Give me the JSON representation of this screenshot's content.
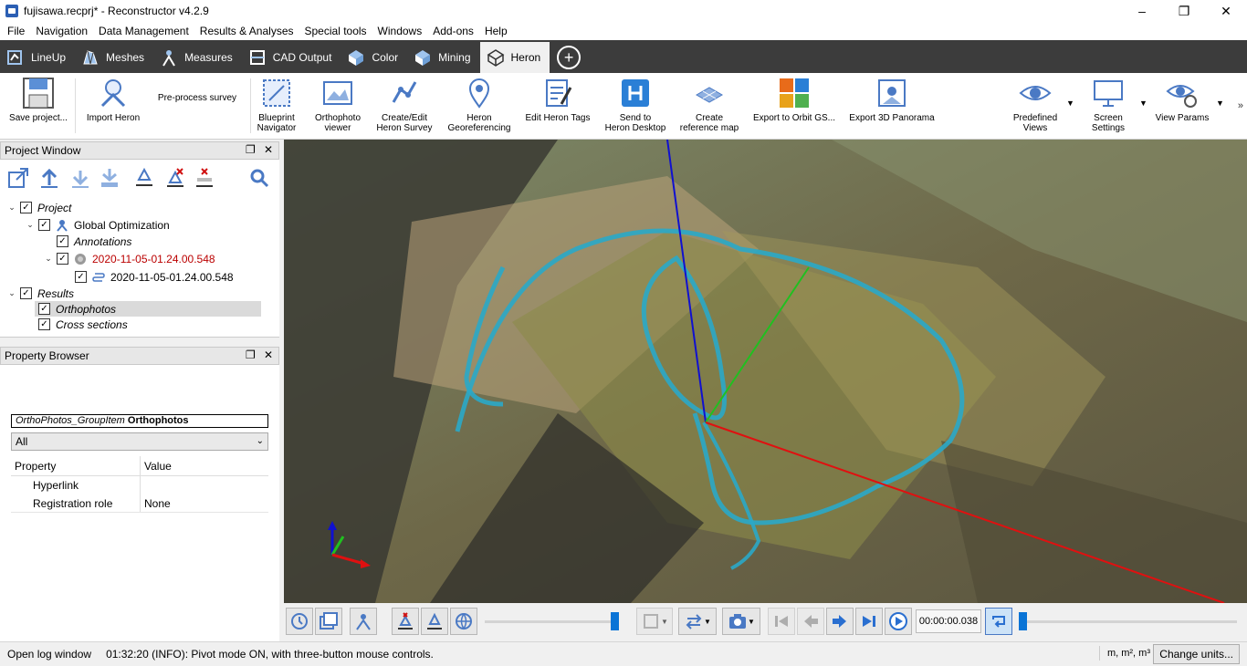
{
  "window": {
    "title": "fujisawa.recprj* - Reconstructor v4.2.9",
    "minimize": "–",
    "maximize": "❐",
    "close": "✕"
  },
  "menu": [
    "File",
    "Navigation",
    "Data Management",
    "Results & Analyses",
    "Special tools",
    "Windows",
    "Add-ons",
    "Help"
  ],
  "ribbon_tabs": [
    {
      "label": "LineUp",
      "icon": "lineup-icon"
    },
    {
      "label": "Meshes",
      "icon": "meshes-icon"
    },
    {
      "label": "Measures",
      "icon": "measures-icon"
    },
    {
      "label": "CAD Output",
      "icon": "cad-output-icon"
    },
    {
      "label": "Color",
      "icon": "color-icon"
    },
    {
      "label": "Mining",
      "icon": "mining-icon"
    },
    {
      "label": "Heron",
      "icon": "heron-icon",
      "active": true
    }
  ],
  "add_tab": "+",
  "ribbon": {
    "save_project": "Save project...",
    "import_heron": "Import Heron",
    "preprocess_survey": "Pre-process survey",
    "blueprint_navigator_1": "Blueprint",
    "blueprint_navigator_2": "Navigator",
    "orthophoto_viewer_1": "Orthophoto",
    "orthophoto_viewer_2": "viewer",
    "create_edit_1": "Create/Edit",
    "create_edit_2": "Heron Survey",
    "heron_georef_1": "Heron",
    "heron_georef_2": "Georeferencing",
    "edit_heron_tags": "Edit Heron Tags",
    "send_to_desktop_1": "Send to",
    "send_to_desktop_2": "Heron Desktop",
    "create_ref_map_1": "Create",
    "create_ref_map_2": "reference map",
    "export_orbit": "Export to Orbit GS...",
    "export_panoramas": "Export 3D Panorama",
    "predefined_views_1": "Predefined",
    "predefined_views_2": "Views",
    "screen_settings_1": "Screen",
    "screen_settings_2": "Settings",
    "view_params": "View Params",
    "more": "»"
  },
  "project_window": {
    "title": "Project Window",
    "float": "❐",
    "close": "✕",
    "tree": [
      {
        "label": "Project",
        "checked": "✓"
      },
      {
        "label": "Global Optimization",
        "checked": "✓"
      },
      {
        "label": "Annotations",
        "checked": "✓"
      },
      {
        "label": "2020-11-05-01.24.00.548",
        "checked": "✓"
      },
      {
        "label": "2020-11-05-01.24.00.548",
        "checked": "✓"
      },
      {
        "label": "Results",
        "checked": "✓"
      },
      {
        "label": "Orthophotos",
        "checked": "✓"
      },
      {
        "label": "Cross sections",
        "checked": "✓"
      }
    ]
  },
  "property_browser": {
    "title": "Property Browser",
    "float": "❐",
    "close": "✕",
    "group_type": "OrthoPhotos_GroupItem",
    "group_name": "Orthophotos",
    "filter": "All",
    "columns": [
      "Property",
      "Value"
    ],
    "rows": [
      {
        "property": "Hyperlink",
        "value": ""
      },
      {
        "property": "Registration role",
        "value": "None"
      }
    ]
  },
  "player": {
    "timecode": "00:00:00.038"
  },
  "status": {
    "log_button": "Open log window",
    "message": "01:32:20 (INFO): Pivot mode ON, with three-button mouse controls.",
    "units": "m, m², m³",
    "change_units": "Change units..."
  },
  "colors": {
    "ribbon_tab_bg": "#3c3c3c",
    "accent_blue": "#0a74d6",
    "axis_x": "#e01010",
    "axis_y": "#20c020",
    "axis_z": "#1010d0",
    "trajectory": "#2aa8c8"
  }
}
